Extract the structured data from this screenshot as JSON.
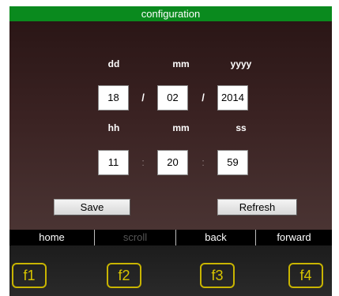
{
  "title": "configuration",
  "date": {
    "labels": {
      "day": "dd",
      "month": "mm",
      "year": "yyyy"
    },
    "values": {
      "day": "18",
      "month": "02",
      "year": "2014"
    },
    "separator": "/"
  },
  "time": {
    "labels": {
      "hour": "hh",
      "minute": "mm",
      "second": "ss"
    },
    "values": {
      "hour": "11",
      "minute": "20",
      "second": "59"
    },
    "separator": ":"
  },
  "buttons": {
    "save": "Save",
    "refresh": "Refresh"
  },
  "nav": {
    "home": "home",
    "scroll": "scroll",
    "back": "back",
    "forward": "forward",
    "scroll_enabled": false
  },
  "fkeys": [
    "f1",
    "f2",
    "f3",
    "f4"
  ],
  "colors": {
    "title_bar": "#0a8a1e",
    "fkey_outline": "#c8b400",
    "panel_bg": "#3a2222"
  }
}
